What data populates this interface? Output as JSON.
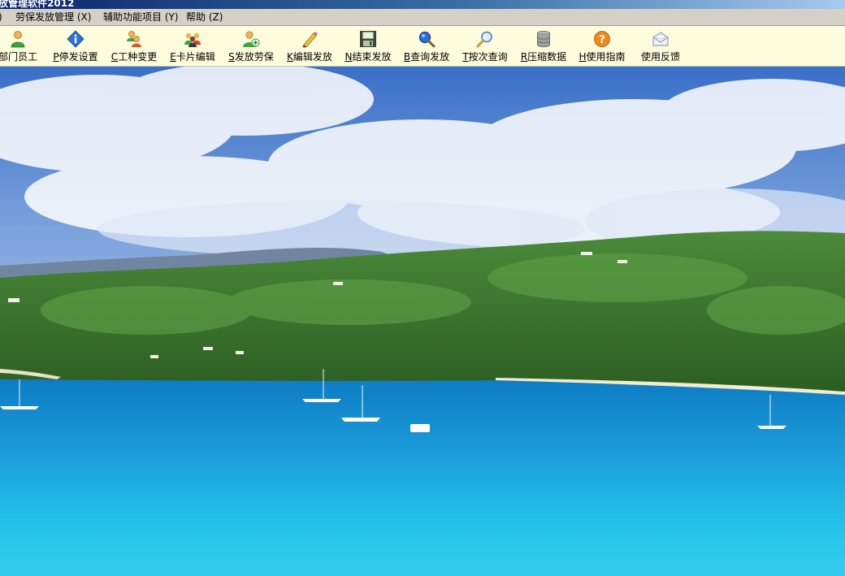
{
  "window": {
    "title": "放管理软件2012"
  },
  "menubar": {
    "items": [
      {
        "label": ")"
      },
      {
        "label": "劳保发放管理 (X)"
      },
      {
        "label": "辅助功能项目 (Y)"
      },
      {
        "label": "帮助 (Z)"
      }
    ]
  },
  "toolbar": {
    "buttons": [
      {
        "hotkey": "",
        "label": "部门员工",
        "icon": "employee-icon"
      },
      {
        "hotkey": "P",
        "label": "停发设置",
        "icon": "info-icon"
      },
      {
        "hotkey": "C",
        "label": "工种变更",
        "icon": "job-change-icon"
      },
      {
        "hotkey": "E",
        "label": "卡片编辑",
        "icon": "card-edit-icon"
      },
      {
        "hotkey": "S",
        "label": "发放劳保",
        "icon": "user-add-icon"
      },
      {
        "hotkey": "K",
        "label": "编辑发放",
        "icon": "pencil-icon"
      },
      {
        "hotkey": "N",
        "label": "结束发放",
        "icon": "save-disk-icon"
      },
      {
        "hotkey": "B",
        "label": "查询发放",
        "icon": "search-icon"
      },
      {
        "hotkey": "T",
        "label": "按次查询",
        "icon": "magnifier-icon"
      },
      {
        "hotkey": "R",
        "label": "压缩数据",
        "icon": "database-icon"
      },
      {
        "hotkey": "H",
        "label": "使用指南",
        "icon": "help-icon"
      },
      {
        "hotkey": "",
        "label": "使用反馈",
        "icon": "mail-icon"
      }
    ]
  },
  "colors": {
    "toolbar_bg": "#fdfcdc",
    "menubar_bg": "#d4d0c8",
    "titlebar": "#0a246a"
  }
}
